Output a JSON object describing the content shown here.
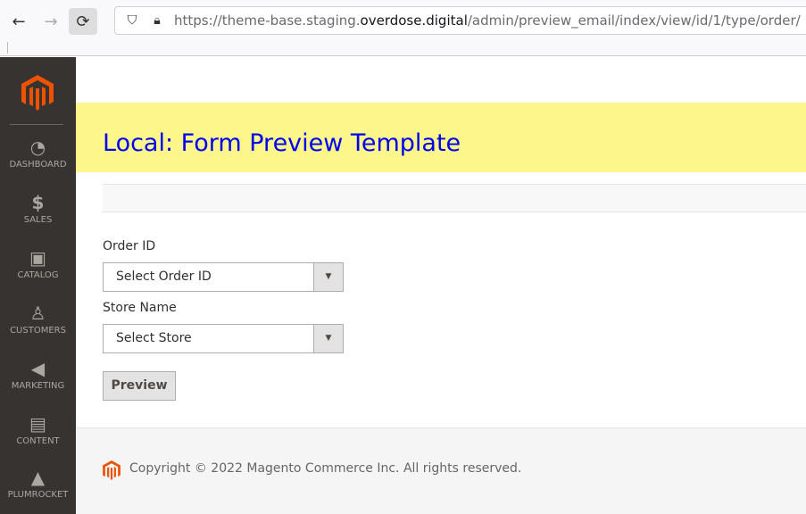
{
  "browser": {
    "url_prefix": "https://theme-base.staging.",
    "url_domain": "overdose.digital",
    "url_path": "/admin/preview_email/index/view/id/1/type/order/"
  },
  "sidebar": {
    "items": [
      {
        "label": "DASHBOARD",
        "icon": "dashboard-icon"
      },
      {
        "label": "SALES",
        "icon": "dollar-icon"
      },
      {
        "label": "CATALOG",
        "icon": "box-icon"
      },
      {
        "label": "CUSTOMERS",
        "icon": "person-icon"
      },
      {
        "label": "MARKETING",
        "icon": "megaphone-icon"
      },
      {
        "label": "CONTENT",
        "icon": "layout-icon"
      },
      {
        "label": "PLUMROCKET",
        "icon": "plumrocket-icon"
      }
    ]
  },
  "colors": {
    "brand": "#eb5202",
    "sidebar": "#373330",
    "banner": "#fdf68b",
    "title": "#0000ee"
  },
  "page": {
    "title": "Local: Form Preview Template"
  },
  "form": {
    "order_label": "Order ID",
    "order_value": "Select Order ID",
    "store_label": "Store Name",
    "store_value": "Select Store",
    "preview_label": "Preview"
  },
  "footer": {
    "copyright": "Copyright © 2022 Magento Commerce Inc. All rights reserved."
  }
}
